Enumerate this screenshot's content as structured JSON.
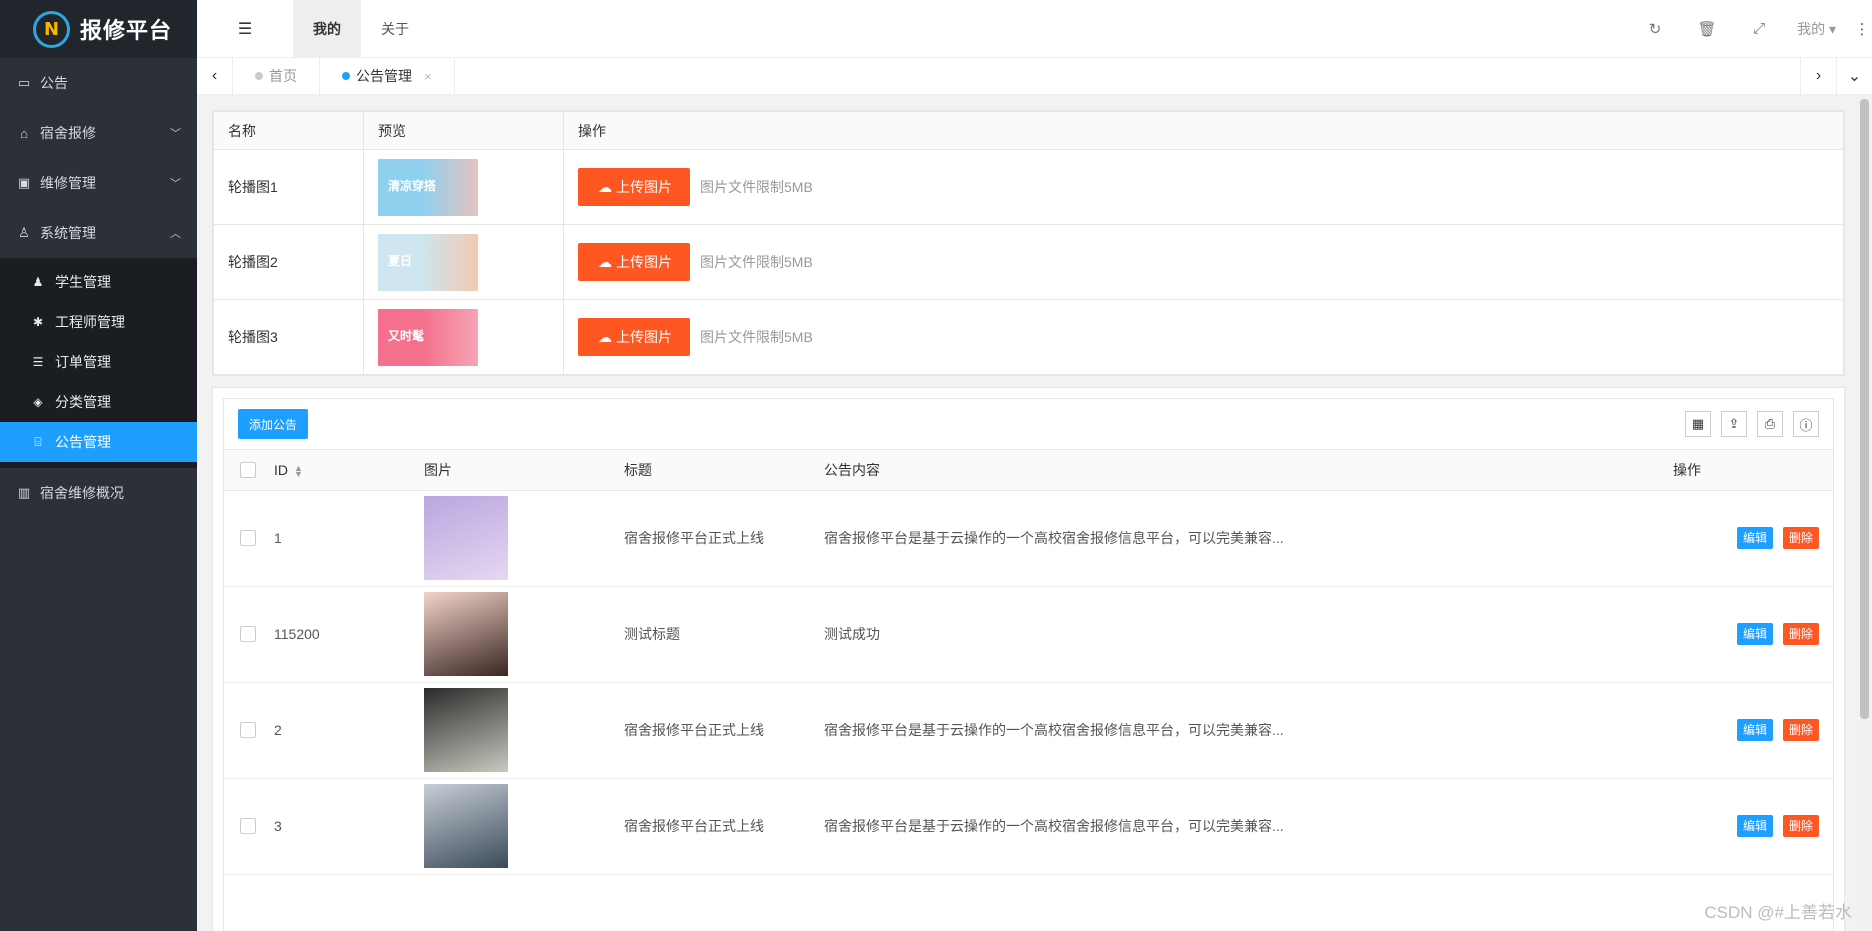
{
  "app": {
    "title": "报修平台"
  },
  "sidebar": {
    "items": [
      {
        "label": "公告",
        "icon": "window-icon"
      },
      {
        "label": "宿舍报修",
        "icon": "home-icon"
      },
      {
        "label": "维修管理",
        "icon": "briefcase-icon"
      },
      {
        "label": "系统管理",
        "icon": "users-icon"
      }
    ],
    "sub_items": [
      {
        "label": "学生管理",
        "icon": "user-icon"
      },
      {
        "label": "工程师管理",
        "icon": "asterisk-icon"
      },
      {
        "label": "订单管理",
        "icon": "list-icon"
      },
      {
        "label": "分类管理",
        "icon": "tags-icon"
      },
      {
        "label": "公告管理",
        "icon": "bank-icon"
      }
    ],
    "last_item": {
      "label": "宿舍维修概况",
      "icon": "bar-chart-icon"
    }
  },
  "header": {
    "tabs": [
      "我的",
      "关于"
    ],
    "user": "我的"
  },
  "tabstrip": {
    "tabs": [
      {
        "label": "首页"
      },
      {
        "label": "公告管理"
      }
    ]
  },
  "carousel": {
    "headers": [
      "名称",
      "预览",
      "操作"
    ],
    "upload_label": "上传图片",
    "hint": "图片文件限制5MB",
    "rows": [
      {
        "name": "轮播图1",
        "overlay": "清凉穿搭",
        "colors": [
          "#8fd0ee",
          "#e7c3c0"
        ]
      },
      {
        "name": "轮播图2",
        "overlay": "夏日",
        "colors": [
          "#cfe5ef",
          "#f1c9b2"
        ]
      },
      {
        "name": "轮播图3",
        "overlay": "又时髦",
        "colors": [
          "#f5708c",
          "#f7a4b5"
        ]
      }
    ]
  },
  "notices": {
    "add_label": "添加公告",
    "headers": {
      "id": "ID",
      "image": "图片",
      "title": "标题",
      "content": "公告内容",
      "actions": "操作"
    },
    "edit_label": "编辑",
    "delete_label": "删除",
    "rows": [
      {
        "id": "1",
        "title": "宿舍报修平台正式上线",
        "content": "宿舍报修平台是基于云操作的一个高校宿舍报修信息平台，可以完美兼容...",
        "colors": [
          "#b8a6e0",
          "#e6d7f0"
        ]
      },
      {
        "id": "115200",
        "title": "测试标题",
        "content": "测试成功",
        "colors": [
          "#f2d4cc",
          "#3a2520"
        ]
      },
      {
        "id": "2",
        "title": "宿舍报修平台正式上线",
        "content": "宿舍报修平台是基于云操作的一个高校宿舍报修信息平台，可以完美兼容...",
        "colors": [
          "#2a2a2a",
          "#c9c9c0"
        ]
      },
      {
        "id": "3",
        "title": "宿舍报修平台正式上线",
        "content": "宿舍报修平台是基于云操作的一个高校宿舍报修信息平台，可以完美兼容...",
        "colors": [
          "#c7ced6",
          "#3b4a5a"
        ]
      }
    ]
  },
  "watermark": "CSDN @#上善若水"
}
